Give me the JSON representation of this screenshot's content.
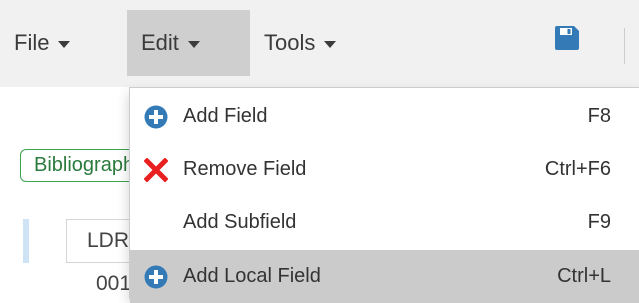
{
  "menubar": {
    "file_label": "File",
    "edit_label": "Edit",
    "tools_label": "Tools",
    "save_icon": "floppy-disk-icon"
  },
  "background": {
    "tag_label": "Bibliographic",
    "ldr_label": "LDR",
    "field_001": "001"
  },
  "edit_menu": {
    "items": [
      {
        "label": "Add Field",
        "shortcut": "F8",
        "icon": "plus-circle-icon"
      },
      {
        "label": "Remove Field",
        "shortcut": "Ctrl+F6",
        "icon": "red-x-icon"
      },
      {
        "label": "Add Subfield",
        "shortcut": "F9",
        "icon": ""
      },
      {
        "label": "Add Local Field",
        "shortcut": "Ctrl+L",
        "icon": "plus-circle-icon"
      }
    ]
  },
  "colors": {
    "accent_blue": "#337ab7",
    "remove_red": "#e8201f",
    "highlight": "#cbcbcb",
    "tag_green": "#3aa552"
  }
}
